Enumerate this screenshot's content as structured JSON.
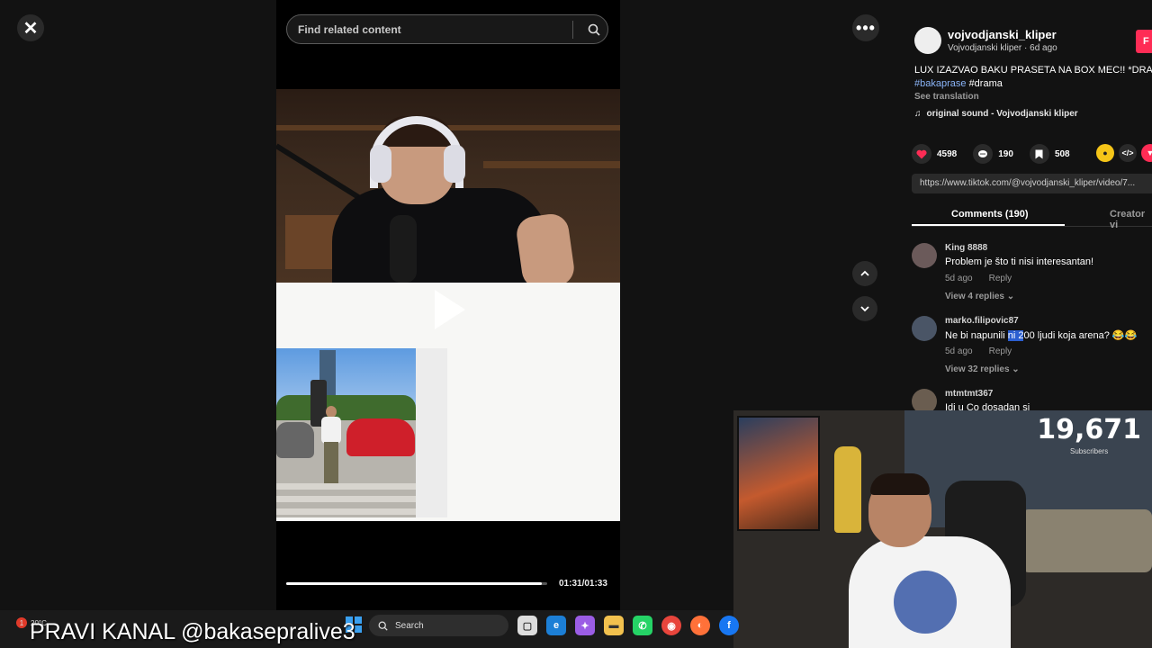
{
  "video": {
    "search_placeholder": "Find related content",
    "time": "01:31/01:33",
    "progress": 0.98
  },
  "post": {
    "username": "vojvodjanski_kliper",
    "subline": "Vojvodjanski kliper · 6d ago",
    "follow_label": "F",
    "caption": "LUX IZAZVAO BAKU PRASETA NA BOX MEC!! *DRA",
    "hashtag1": "#bakaprase",
    "hashtag2": "#drama",
    "see_translation": "See translation",
    "sound": "original sound - Vojvodjanski kliper",
    "likes": "4598",
    "comments": "190",
    "saves": "508",
    "url": "https://www.tiktok.com/@vojvodjanski_kliper/video/7...",
    "tab_comments": "Comments (190)",
    "tab_creator": "Creator vi"
  },
  "comments": [
    {
      "user": "King 8888",
      "text": "Problem je što ti nisi interesantan!",
      "age": "5d ago",
      "reply": "Reply",
      "replies": "View 4 replies ⌄"
    },
    {
      "user": "marko.filipovic87",
      "text_pre": "Ne bi napunili ",
      "text_hl": "ni 2",
      "text_post": "00 ljudi koja arena? 😂😂",
      "age": "5d ago",
      "reply": "Reply",
      "replies": "View 32 replies ⌄"
    },
    {
      "user": "mtmtmt367",
      "text": "Idi u Co dosadan si"
    }
  ],
  "webcam": {
    "subscriber_count": "19,671",
    "subscriber_label": "Subscribers"
  },
  "taskbar": {
    "weather": "20°C",
    "badge": "1",
    "search_label": "Search"
  },
  "banner": "PRAVI KANAL @bakasepralive3",
  "colors": {
    "accent": "#fe2c55",
    "hashtag": "#8ab4f8"
  }
}
